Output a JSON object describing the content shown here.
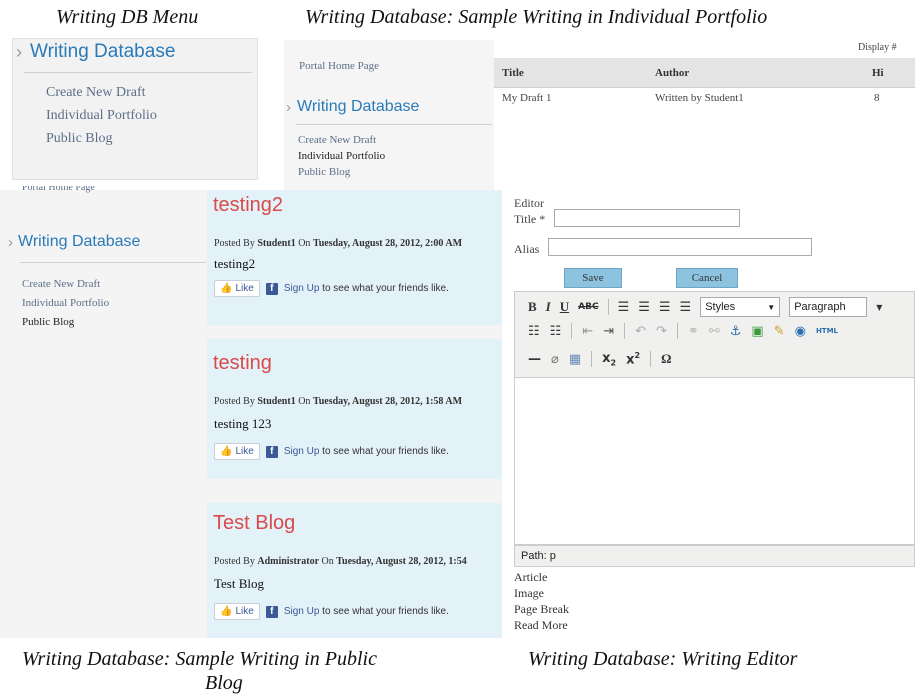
{
  "captions": {
    "menu": "Writing DB Menu",
    "portfolio": "Writing Database: Sample Writing in Individual Portfolio",
    "blog_line1": "Writing Database: Sample Writing in Public",
    "blog_line2": "Blog",
    "editor": "Writing Database: Writing Editor"
  },
  "menu_panel": {
    "heading": "Writing Database",
    "items": [
      "Create New Draft",
      "Individual Portfolio",
      "Public Blog"
    ]
  },
  "portfolio": {
    "side": {
      "home_link": "Portal Home Page",
      "heading": "Writing Database",
      "items": [
        "Create New Draft",
        "Individual Portfolio",
        "Public Blog"
      ]
    },
    "display_label": "Display #",
    "columns": [
      "Title",
      "Author",
      "Hi"
    ],
    "rows": [
      {
        "title": "My Draft 1",
        "author": "Written by Student1",
        "hits": "8"
      }
    ]
  },
  "blog": {
    "side": {
      "home_link": "Portal Home Page",
      "heading": "Writing Database",
      "items": [
        "Create New Draft",
        "Individual Portfolio",
        "Public Blog"
      ]
    },
    "like_label": "Like",
    "signup_link": "Sign Up",
    "signup_rest": " to see what your friends like.",
    "posts": [
      {
        "title": "testing2",
        "meta_prefix": "Posted By ",
        "author": "Student1",
        "meta_mid": " On ",
        "date": "Tuesday, August 28, 2012, 2:00 AM",
        "body": "testing2"
      },
      {
        "title": "testing",
        "meta_prefix": "Posted By ",
        "author": "Student1",
        "meta_mid": " On ",
        "date": "Tuesday, August 28, 2012, 1:58 AM",
        "body": "testing 123"
      },
      {
        "title": "Test Blog",
        "meta_prefix": "Posted By ",
        "author": "Administrator",
        "meta_mid": " On ",
        "date": "Tuesday, August 28, 2012, 1:54",
        "body": "Test Blog"
      }
    ]
  },
  "editor": {
    "editor_label": "Editor",
    "title_label": "Title *",
    "alias_label": "Alias",
    "title_value": "",
    "alias_value": "",
    "save_label": "Save",
    "cancel_label": "Cancel",
    "styles_value": "Styles",
    "paragraph_value": "Paragraph",
    "path_text": "Path: p",
    "extra_buttons": [
      "Article",
      "Image",
      "Page Break",
      "Read More"
    ]
  }
}
